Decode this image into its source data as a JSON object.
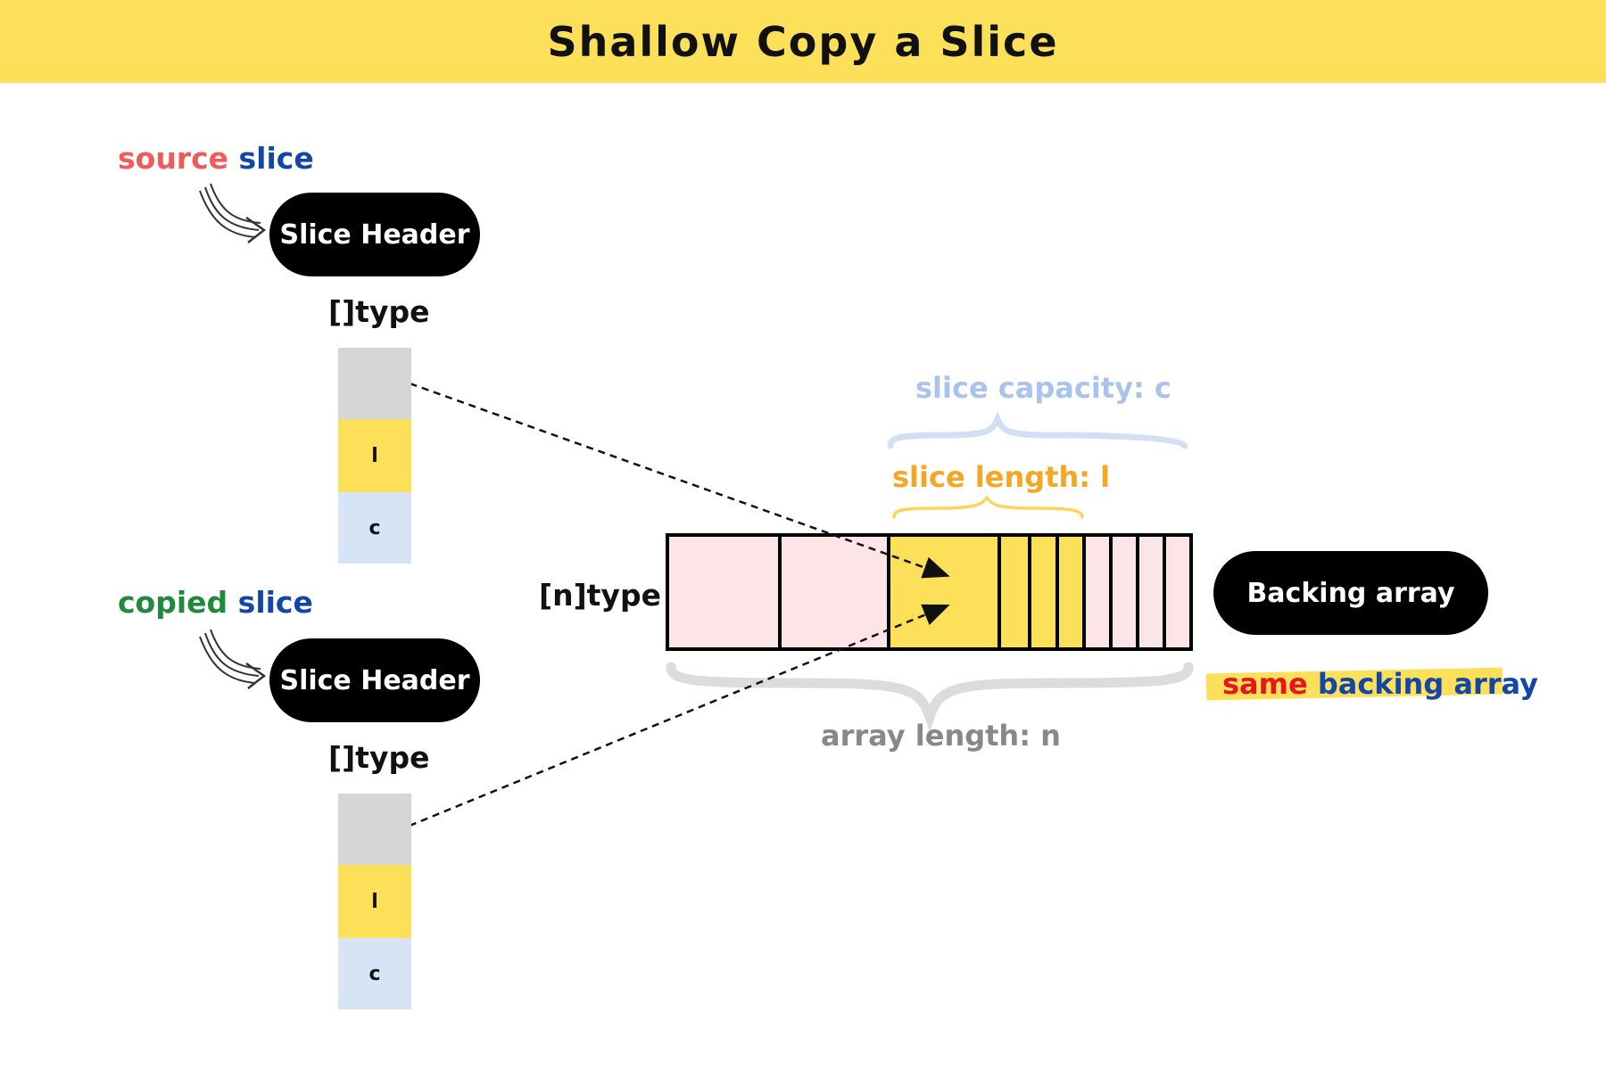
{
  "title": "Shallow Copy a Slice",
  "source": {
    "label_word1": "source",
    "label_word2": "slice",
    "header": "Slice Header",
    "type": "[]type",
    "cells": [
      "",
      "l",
      "c"
    ]
  },
  "copied": {
    "label_word1": "copied",
    "label_word2": "slice",
    "header": "Slice Header",
    "type": "[]type",
    "cells": [
      "",
      "l",
      "c"
    ]
  },
  "array": {
    "type": "[n]type",
    "capacity_label": "slice capacity: c",
    "length_label": "slice length: l",
    "array_length_label": "array length: n",
    "backing_label": "Backing array",
    "note_word1": "same",
    "note_word2": "backing array"
  },
  "colors": {
    "banner": "#fde05a",
    "source_word": "#f05a5a",
    "slice_word": "#1246a8",
    "copied_word": "#1f8a3c",
    "pointer_cell": "#d6d6d6",
    "length_cell": "#fde05a",
    "capacity_cell": "#d7e4f5",
    "array_pink": "#fde4e6",
    "capacity_brace": "#a9c4ec",
    "length_brace": "#f5a623",
    "array_brace": "#888888",
    "same_word": "#e8141e"
  }
}
